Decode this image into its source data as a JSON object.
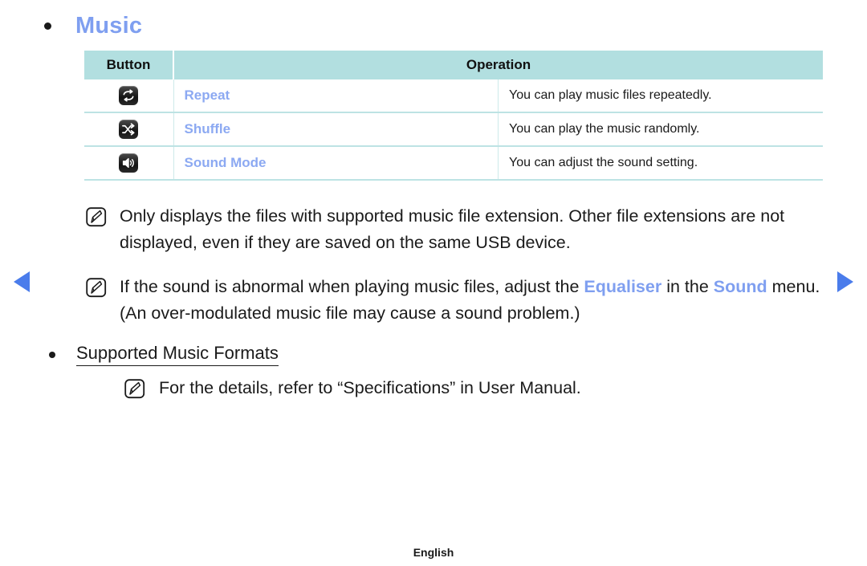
{
  "nav": {
    "prev_label": "Previous page",
    "prev_icon": "triangle-left-icon",
    "next_label": "Next page",
    "next_icon": "triangle-right-icon",
    "arrow_color": "#4a7ceb"
  },
  "section": {
    "title": "Music",
    "title_color": "#7f9ff0"
  },
  "table": {
    "header_bg": "#b2dfe0",
    "columns": [
      "Button",
      "Operation"
    ],
    "rows": [
      {
        "icon": "repeat-icon",
        "label": "Repeat",
        "description": "You can play music files repeatedly."
      },
      {
        "icon": "shuffle-icon",
        "label": "Shuffle",
        "description": "You can play the music randomly."
      },
      {
        "icon": "sound-mode-icon",
        "label": "Sound Mode",
        "description": "You can adjust the sound setting."
      }
    ],
    "label_color": "#8ca9f2"
  },
  "notes": [
    {
      "icon": "note-pen-icon",
      "parts": [
        {
          "text": "Only displays the files with supported music file extension. Other file extensions are not displayed, even if they are saved on the same USB device.",
          "style": "normal"
        }
      ]
    },
    {
      "icon": "note-pen-icon",
      "parts": [
        {
          "text": "If the sound is abnormal when playing music files, adjust the ",
          "style": "normal"
        },
        {
          "text": "Equaliser",
          "style": "highlight"
        },
        {
          "text": " in the ",
          "style": "normal"
        },
        {
          "text": "Sound",
          "style": "highlight"
        },
        {
          "text": " menu. (An over-modulated music file may cause a sound problem.)",
          "style": "normal"
        }
      ]
    }
  ],
  "sub_section": {
    "title": "Supported Music Formats",
    "note": {
      "icon": "note-pen-icon",
      "text": "For the details, refer to “Specifications” in User Manual."
    }
  },
  "footer": {
    "language": "English"
  }
}
